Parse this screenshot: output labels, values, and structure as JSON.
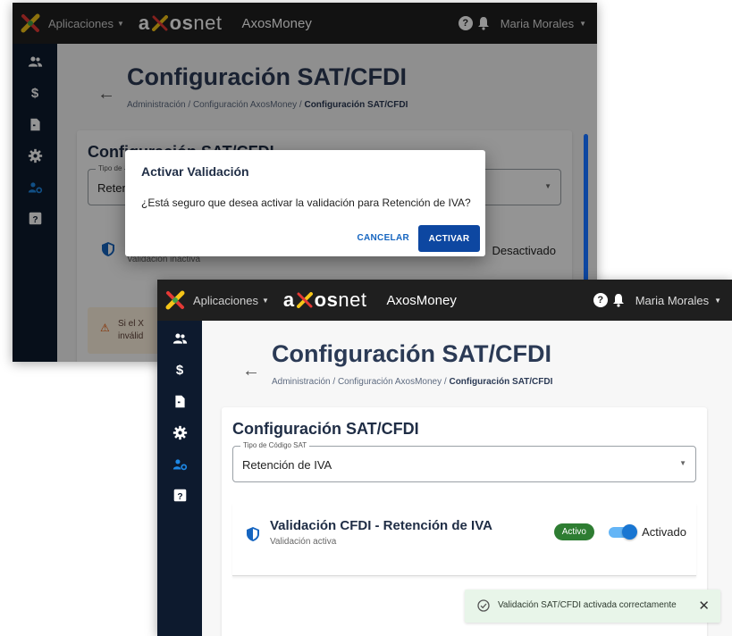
{
  "colors": {
    "topbar": "#1f1f1f",
    "sidenav": "#0d1a2e",
    "primary": "#0d47a1",
    "success": "#2e7d32",
    "toast_bg": "#e8f5e9"
  },
  "icons": {
    "logo": "colorful-x-logo-icon",
    "help": "help-icon",
    "bell": "bell-icon",
    "back": "arrow-left-icon",
    "shield": "shield-icon",
    "warning": "warning-icon",
    "check": "check-circle-icon",
    "close": "close-icon",
    "nav": [
      "users-icon",
      "dollar-icon",
      "document-icon",
      "gear-icon",
      "user-settings-icon",
      "help-box-icon"
    ]
  },
  "topbar": {
    "apps_label": "Aplicaciones",
    "brand_a": "a",
    "brand_rest_bold": "os",
    "brand_rest_thin": "net",
    "product": "AxosMoney",
    "user": "Maria Morales",
    "help_glyph": "?"
  },
  "page": {
    "back_glyph": "←",
    "title": "Configuración SAT/CFDI",
    "breadcrumb": [
      "Administración",
      "Configuración AxosMoney",
      "Configuración SAT/CFDI"
    ],
    "breadcrumb_sep": "/"
  },
  "card": {
    "title": "Configuración SAT/CFDI",
    "select_legend": "Tipo de Código SAT",
    "select_value": "Retención de IVA"
  },
  "before": {
    "card_title_partial": "Configuración SAT/CFDI",
    "legend_partial": "Tipo de",
    "select_partial": "Reten",
    "val_sub": "Validación inactiva",
    "toggle_label": "Desactivado",
    "warning_line1": "Si el X",
    "warning_line2": "inválid"
  },
  "dialog": {
    "title": "Activar Validación",
    "message": "¿Está seguro que desea activar la validación para Retención de IVA?",
    "cancel": "CANCELAR",
    "confirm": "ACTIVAR"
  },
  "validation": {
    "title": "Validación CFDI - Retención de IVA",
    "subtitle": "Validación activa",
    "badge": "Activo",
    "toggle_label": "Activado",
    "enabled": true
  },
  "toast": {
    "message": "Validación SAT/CFDI activada correctamente",
    "close_glyph": "✕"
  }
}
